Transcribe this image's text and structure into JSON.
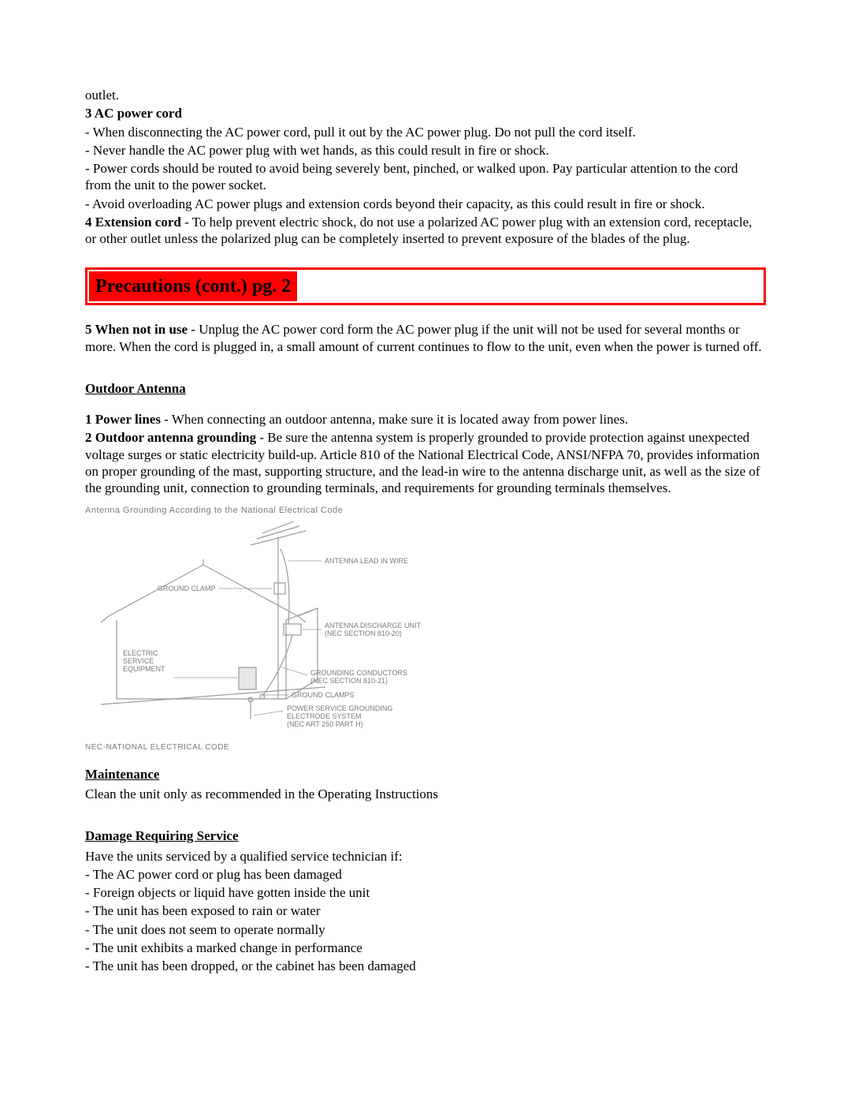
{
  "top": {
    "outlet_trail": "outlet.",
    "heading3": "3   AC power cord",
    "ac_items": [
      "- When disconnecting the AC power cord, pull it out by the AC power plug.  Do not pull the cord itself.",
      "- Never handle the AC power plug with wet hands, as this could result in fire or shock.",
      "- Power cords should be routed to avoid being severely bent, pinched, or walked upon.  Pay particular attention to the cord from the unit to the power socket.",
      "- Avoid overloading AC power plugs and extension cords beyond their capacity, as this could result in fire or shock."
    ],
    "heading4_lead": "4   Extension cord",
    "heading4_body": " - To help prevent electric shock, do not use a polarized AC power plug with an extension cord, receptacle, or other outlet unless the polarized plug can be completely inserted to prevent exposure of the blades of the plug."
  },
  "banner": "Precautions (cont.)     pg. 2",
  "item5": {
    "lead": "5   When not in use",
    "body": " - Unplug the AC power cord form the AC power plug if the unit will not be used for several months or more.  When the cord is plugged in, a small amount of current continues to flow to the unit, even when the power is turned off."
  },
  "outdoor": {
    "heading": "Outdoor Antenna",
    "item1_lead": "1   Power lines",
    "item1_body": " - When connecting an outdoor antenna, make sure it is located away from power lines.",
    "item2_lead": "2   Outdoor antenna grounding",
    "item2_body": " - Be sure the antenna system is properly grounded to provide protection against unexpected voltage surges or static electricity build-up. Article 810 of the National Electrical Code, ANSI/NFPA 70, provides information on proper grounding of the mast, supporting structure, and the lead-in wire to the antenna discharge unit, as well as the size of the grounding unit, connection to grounding terminals, and requirements for grounding terminals themselves."
  },
  "diagram": {
    "title": "Antenna Grounding According to the National Electrical Code",
    "labels": {
      "antenna_lead": "ANTENNA LEAD IN WIRE",
      "ground_clamp_top": "GROUND CLAMP",
      "discharge": "ANTENNA DISCHARGE UNIT",
      "discharge_sub": "(NEC SECTION 810-20)",
      "electric1": "ELECTRIC",
      "electric2": "SERVICE",
      "electric3": "EQUIPMENT",
      "conductors": "GROUNDING CONDUCTORS",
      "conductors_sub": "(NEC SECTION 810-21)",
      "ground_clamps_bottom": "GROUND CLAMPS",
      "power1": "POWER SERVICE GROUNDING",
      "power2": "ELECTRODE SYSTEM",
      "power3": "(NEC ART 250 PART H)"
    },
    "footer": "NEC-NATIONAL ELECTRICAL CODE"
  },
  "maintenance": {
    "heading": "Maintenance",
    "body": "Clean the unit only as recommended in the Operating Instructions"
  },
  "damage": {
    "heading": "Damage Requiring Service",
    "intro": "Have the units serviced by a qualified service technician if:",
    "items": [
      "- The AC power cord or plug has been damaged",
      "- Foreign objects or liquid have gotten inside the unit",
      "- The unit has been exposed to rain or water",
      "- The unit does not seem to operate normally",
      "- The unit exhibits a marked change in performance",
      "- The unit has been dropped, or the cabinet has been damaged"
    ]
  }
}
